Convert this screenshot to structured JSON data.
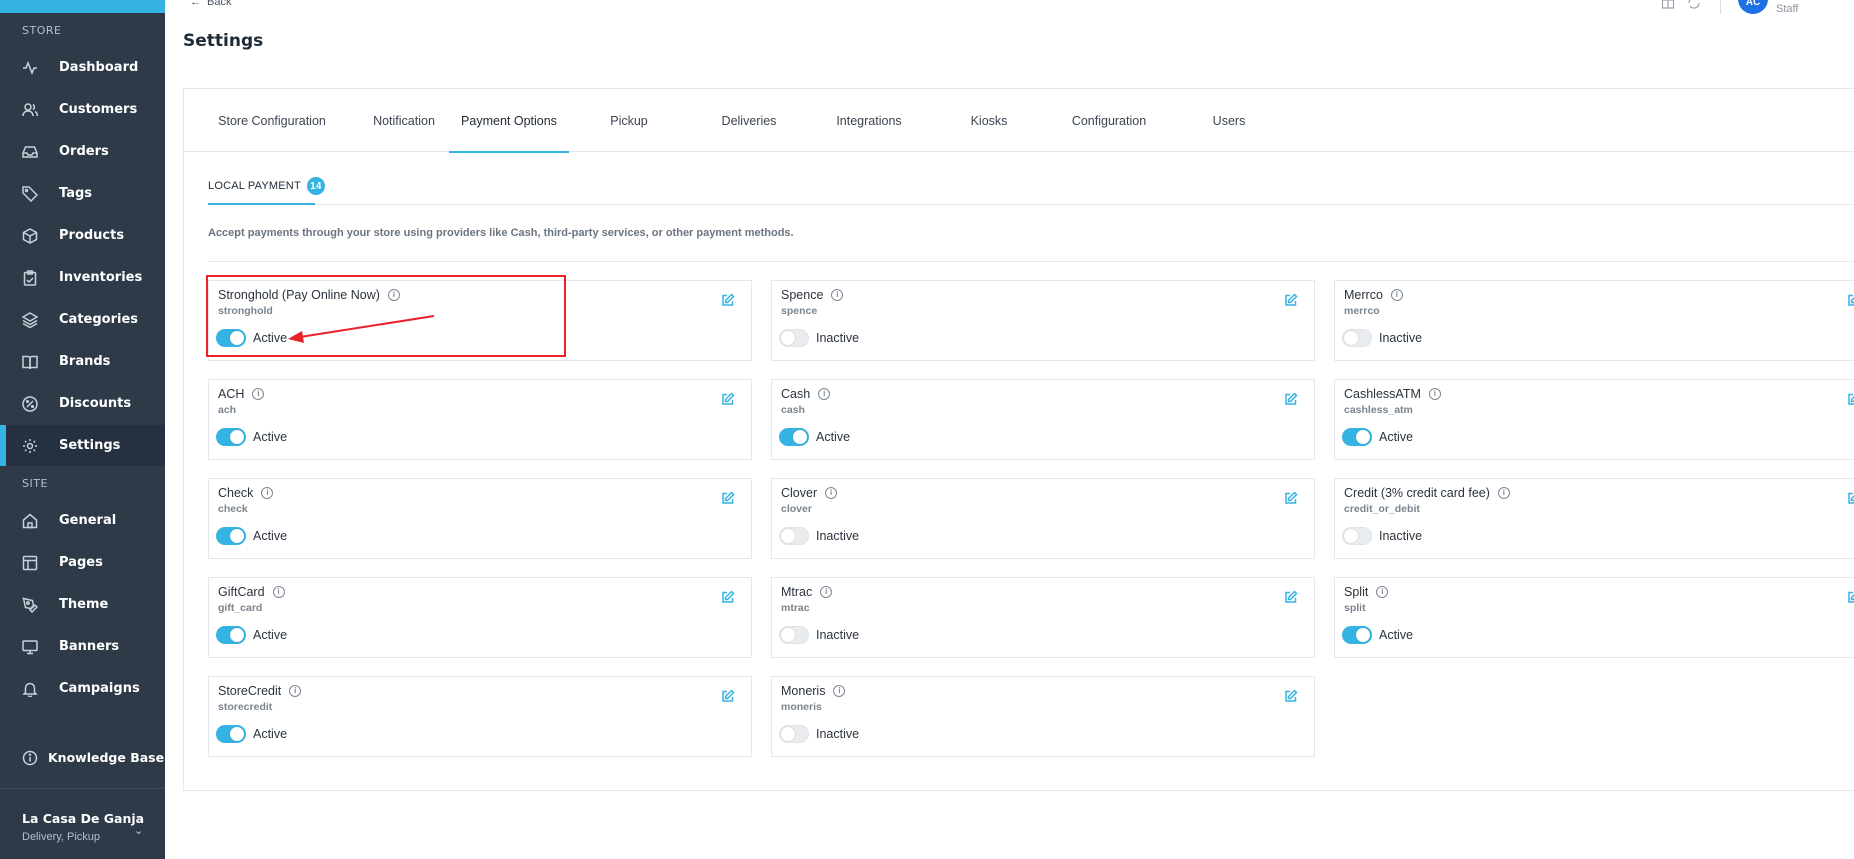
{
  "sidebar": {
    "section_store": "STORE",
    "section_site": "SITE",
    "items": [
      {
        "label": "Dashboard",
        "icon": "activity-icon"
      },
      {
        "label": "Customers",
        "icon": "users-icon"
      },
      {
        "label": "Orders",
        "icon": "inbox-icon"
      },
      {
        "label": "Tags",
        "icon": "tag-icon"
      },
      {
        "label": "Products",
        "icon": "box-icon"
      },
      {
        "label": "Inventories",
        "icon": "clipboard-icon"
      },
      {
        "label": "Categories",
        "icon": "layers-icon"
      },
      {
        "label": "Brands",
        "icon": "book-icon"
      },
      {
        "label": "Discounts",
        "icon": "percent-icon"
      },
      {
        "label": "Settings",
        "icon": "gear-icon"
      }
    ],
    "site_items": [
      {
        "label": "General",
        "icon": "home-icon"
      },
      {
        "label": "Pages",
        "icon": "layout-icon"
      },
      {
        "label": "Theme",
        "icon": "pen-tool-icon"
      },
      {
        "label": "Banners",
        "icon": "monitor-icon"
      },
      {
        "label": "Campaigns",
        "icon": "bell-icon"
      }
    ],
    "knowledge_base": "Knowledge Base",
    "store_name": "La Casa De Ganja",
    "store_sub": "Delivery, Pickup"
  },
  "header": {
    "back": "Back",
    "title": "Settings",
    "avatar_initials": "AC",
    "role": "Staff"
  },
  "tabs": [
    "Store Configuration",
    "Notification",
    "Payment Options",
    "Pickup",
    "Deliveries",
    "Integrations",
    "Kiosks",
    "Configuration",
    "Users"
  ],
  "active_tab": "Payment Options",
  "subtab": {
    "label": "LOCAL PAYMENT",
    "count": "14"
  },
  "description": "Accept payments through your store using providers like Cash, third-party services, or other payment methods.",
  "payments": [
    {
      "name": "Stronghold (Pay Online Now)",
      "slug": "stronghold",
      "status": "Active",
      "on": true
    },
    {
      "name": "Spence",
      "slug": "spence",
      "status": "Inactive",
      "on": false
    },
    {
      "name": "Merrco",
      "slug": "merrco",
      "status": "Inactive",
      "on": false
    },
    {
      "name": "ACH",
      "slug": "ach",
      "status": "Active",
      "on": true
    },
    {
      "name": "Cash",
      "slug": "cash",
      "status": "Active",
      "on": true
    },
    {
      "name": "CashlessATM",
      "slug": "cashless_atm",
      "status": "Active",
      "on": true
    },
    {
      "name": "Check",
      "slug": "check",
      "status": "Active",
      "on": true
    },
    {
      "name": "Clover",
      "slug": "clover",
      "status": "Inactive",
      "on": false
    },
    {
      "name": "Credit (3% credit card fee)",
      "slug": "credit_or_debit",
      "status": "Inactive",
      "on": false
    },
    {
      "name": "GiftCard",
      "slug": "gift_card",
      "status": "Active",
      "on": true
    },
    {
      "name": "Mtrac",
      "slug": "mtrac",
      "status": "Inactive",
      "on": false
    },
    {
      "name": "Split",
      "slug": "split",
      "status": "Active",
      "on": true
    },
    {
      "name": "StoreCredit",
      "slug": "storecredit",
      "status": "Active",
      "on": true
    },
    {
      "name": "Moneris",
      "slug": "moneris",
      "status": "Inactive",
      "on": false
    }
  ],
  "colors": {
    "accent": "#35b3e2",
    "sidebar_bg": "#2e3a48",
    "highlight": "#e8212b"
  }
}
